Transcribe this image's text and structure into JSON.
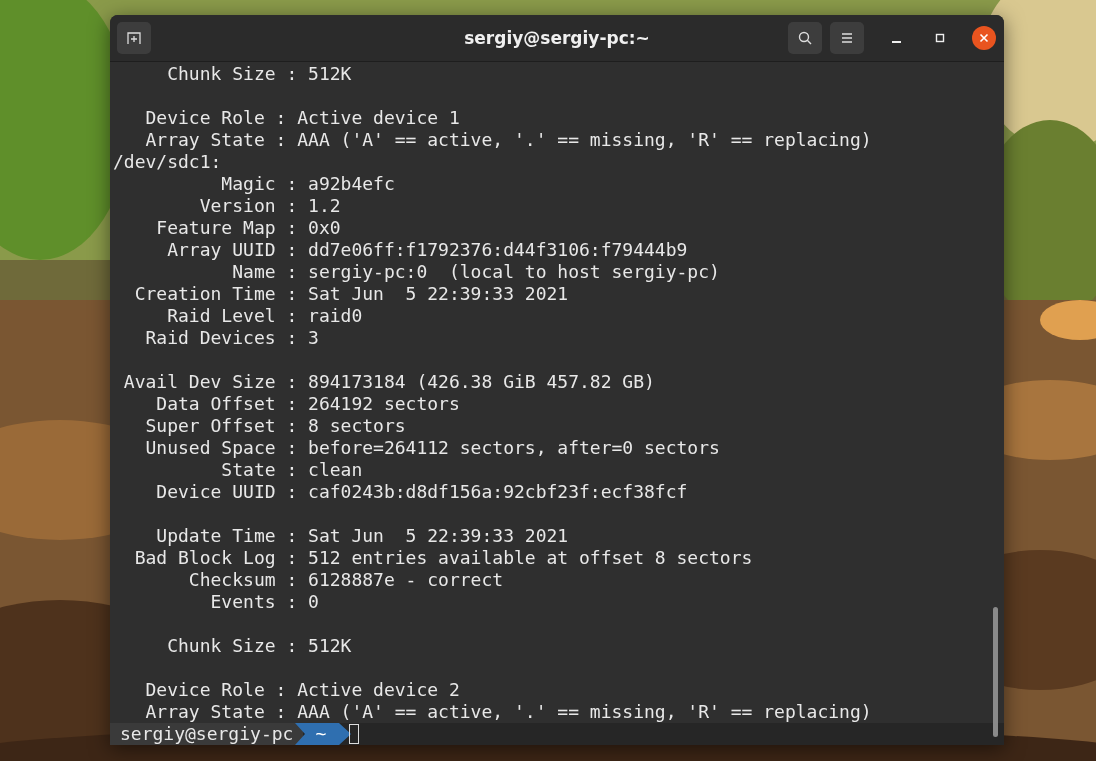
{
  "window": {
    "title": "sergiy@sergiy-pc:~"
  },
  "terminal": {
    "blocks": [
      [
        "     Chunk Size : 512K"
      ],
      [
        "   Device Role : Active device 1",
        "   Array State : AAA ('A' == active, '.' == missing, 'R' == replacing)",
        "/dev/sdc1:",
        "          Magic : a92b4efc",
        "        Version : 1.2",
        "    Feature Map : 0x0",
        "     Array UUID : dd7e06ff:f1792376:d44f3106:f79444b9",
        "           Name : sergiy-pc:0  (local to host sergiy-pc)",
        "  Creation Time : Sat Jun  5 22:39:33 2021",
        "     Raid Level : raid0",
        "   Raid Devices : 3"
      ],
      [
        " Avail Dev Size : 894173184 (426.38 GiB 457.82 GB)",
        "    Data Offset : 264192 sectors",
        "   Super Offset : 8 sectors",
        "   Unused Space : before=264112 sectors, after=0 sectors",
        "          State : clean",
        "    Device UUID : caf0243b:d8df156a:92cbf23f:ecf38fcf"
      ],
      [
        "    Update Time : Sat Jun  5 22:39:33 2021",
        "  Bad Block Log : 512 entries available at offset 8 sectors",
        "       Checksum : 6128887e - correct",
        "         Events : 0"
      ],
      [
        "     Chunk Size : 512K"
      ],
      [
        "   Device Role : Active device 2",
        "   Array State : AAA ('A' == active, '.' == missing, 'R' == replacing)"
      ]
    ],
    "prompt": {
      "user_host": "sergiy@sergiy-pc",
      "directory": "~"
    }
  }
}
